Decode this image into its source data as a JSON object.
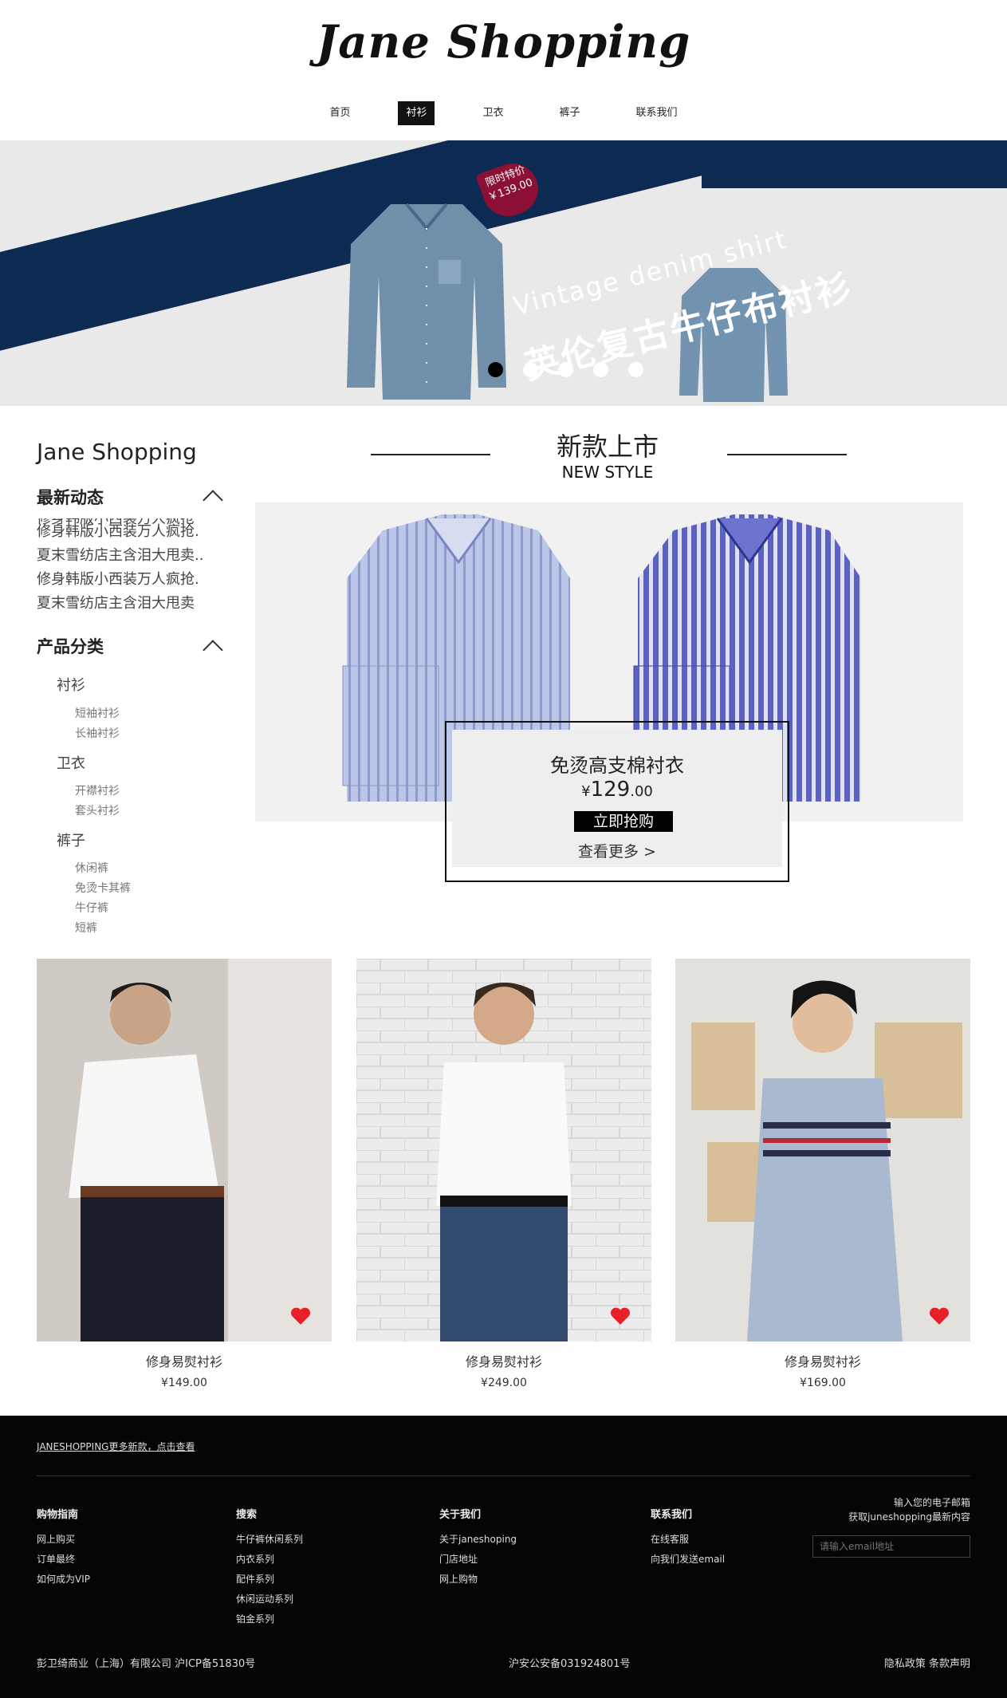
{
  "header": {
    "logo": "Jane Shopping",
    "nav": [
      "首页",
      "衬衫",
      "卫衣",
      "裤子",
      "联系我们"
    ],
    "active_nav": "衬衫"
  },
  "banner": {
    "tag_line1": "限时特价",
    "tag_line2": "￥139.00",
    "title_en": "Vintage  denim shirt",
    "title_cn": "英伦复古牛仔布衬衫",
    "slides": 5,
    "active_slide": 1
  },
  "sidebar": {
    "brand": "Jane Shopping",
    "news_title": "最新动态",
    "news": [
      "修身韩版小西装万人疯抢",
      "修身韩版小西装万人疯抢.",
      "夏末雪纺店主含泪大甩卖..",
      "修身韩版小西装万人疯抢.",
      "夏末雪纺店主含泪大甩卖"
    ],
    "category_title": "产品分类",
    "categories": [
      {
        "name": "衬衫",
        "items": [
          "短袖衬衫",
          "长袖衬衫"
        ]
      },
      {
        "name": "卫衣",
        "items": [
          "开襟衬衫",
          "套头衬衫"
        ]
      },
      {
        "name": "裤子",
        "items": [
          "休闲裤",
          "免烫卡其裤",
          "牛仔裤",
          "短裤"
        ]
      }
    ]
  },
  "new_style": {
    "title_cn": "新款上市",
    "title_en": "NEW STYLE"
  },
  "feature": {
    "name": "免烫高支棉衬衣",
    "currency": "¥",
    "price_int": "129",
    "price_dec": ".00",
    "buy_label": "立即抢购",
    "more_label": "查看更多 >"
  },
  "products": [
    {
      "name": "修身易熨衬衫",
      "price": "¥149.00"
    },
    {
      "name": "修身易熨衬衫",
      "price": "¥249.00"
    },
    {
      "name": "修身易熨衬衫",
      "price": "¥169.00"
    }
  ],
  "footer": {
    "more_link": "JANESHOPPING更多新款，点击查看",
    "columns": [
      {
        "title": "购物指南",
        "links": [
          "网上购买",
          "订单最终",
          "如何成为VIP"
        ]
      },
      {
        "title": "搜索",
        "links": [
          "牛仔裤休闲系列",
          "内衣系列",
          "配件系列",
          "休闲运动系列",
          "铂金系列"
        ]
      },
      {
        "title": "关于我们",
        "links": [
          "关于janeshoping",
          "门店地址",
          "网上购物"
        ]
      },
      {
        "title": "联系我们",
        "links": [
          "在线客服",
          "向我们发送email"
        ]
      }
    ],
    "subscribe_line1": "输入您的电子邮箱",
    "subscribe_line2": "获取juneshopping最新内容",
    "email_placeholder": "请输入email地址",
    "company": "彭卫绮商业（上海）有限公司 沪ICP备51830号",
    "police": "沪安公安备031924801号",
    "legal": "隐私政策 条款声明"
  },
  "colors": {
    "banner_navy": "#0c2a52",
    "tag_red": "#8c1034",
    "heart_red": "#e8202a",
    "footer_bg": "#050505"
  }
}
